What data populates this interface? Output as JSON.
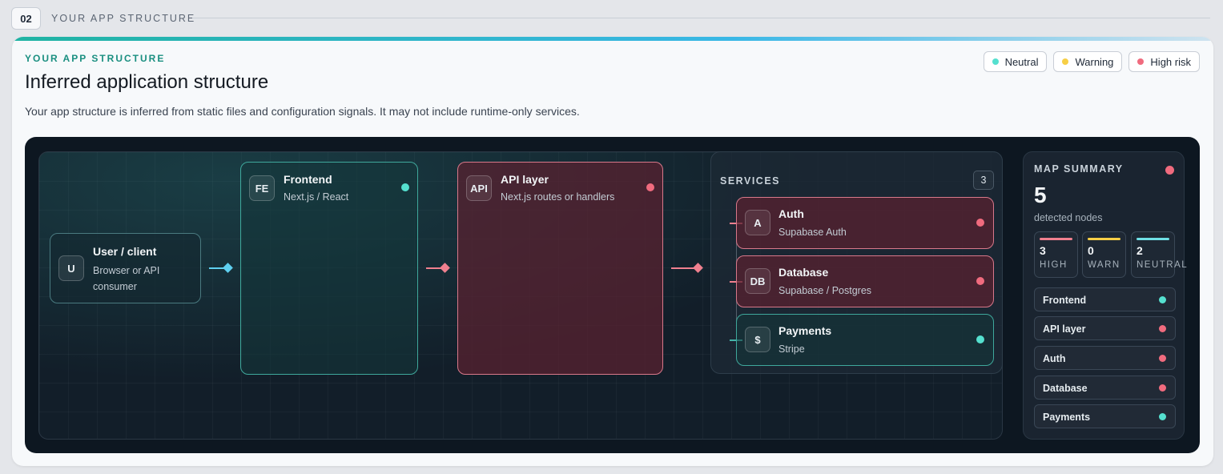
{
  "section": {
    "step": "02",
    "label": "YOUR APP STRUCTURE"
  },
  "card": {
    "eyebrow": "YOUR APP STRUCTURE",
    "title": "Inferred application structure",
    "description": "Your app structure is inferred from static files and configuration signals. It may not include runtime-only services."
  },
  "legend": [
    {
      "label": "Neutral",
      "status": "neutral"
    },
    {
      "label": "Warning",
      "status": "warning"
    },
    {
      "label": "High risk",
      "status": "high"
    }
  ],
  "colors": {
    "neutral": "#55e0cf",
    "warning": "#f7cf46",
    "high": "#f06b7e"
  },
  "nodes": {
    "client": {
      "icon": "U",
      "title": "User / client",
      "subtitle_line1": "Browser or API",
      "subtitle_line2": "consumer"
    },
    "frontend": {
      "icon": "FE",
      "title": "Frontend",
      "subtitle": "Next.js / React",
      "status": "neutral"
    },
    "api": {
      "icon": "API",
      "title": "API layer",
      "subtitle": "Next.js routes or handlers",
      "status": "high"
    }
  },
  "services": {
    "label": "SERVICES",
    "count": "3",
    "items": [
      {
        "icon": "A",
        "title": "Auth",
        "subtitle": "Supabase Auth",
        "status": "high"
      },
      {
        "icon": "DB",
        "title": "Database",
        "subtitle": "Supabase / Postgres",
        "status": "high"
      },
      {
        "icon": "$",
        "title": "Payments",
        "subtitle": "Stripe",
        "status": "neutral"
      }
    ]
  },
  "summary": {
    "label": "MAP SUMMARY",
    "count": "5",
    "caption": "detected nodes",
    "stats": [
      {
        "value": "3",
        "label": "HIGH",
        "status": "high"
      },
      {
        "value": "0",
        "label": "WARN",
        "status": "warning"
      },
      {
        "value": "2",
        "label": "NEUTRAL",
        "status": "neutral"
      }
    ],
    "rows": [
      {
        "label": "Frontend",
        "status": "neutral"
      },
      {
        "label": "API layer",
        "status": "high"
      },
      {
        "label": "Auth",
        "status": "high"
      },
      {
        "label": "Database",
        "status": "high"
      },
      {
        "label": "Payments",
        "status": "neutral"
      }
    ]
  }
}
